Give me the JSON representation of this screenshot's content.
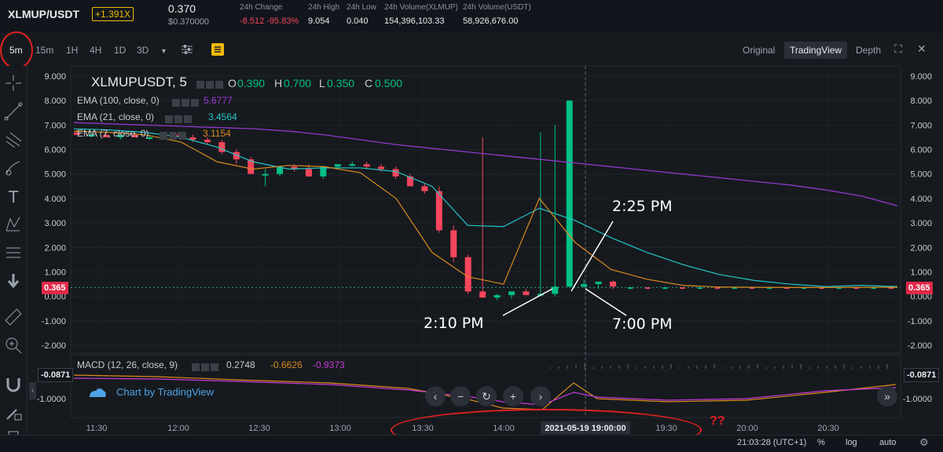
{
  "header": {
    "pair": "XLMUP/USDT",
    "leverage": "+1.391X",
    "price": "0.370",
    "price_sub": "$0.370000",
    "stats": [
      {
        "label": "24h Change",
        "value": "-8.512 -95.83%",
        "color": "#f6465d"
      },
      {
        "label": "24h High",
        "value": "9.054",
        "color": "#eaecef"
      },
      {
        "label": "24h Low",
        "value": "0.040",
        "color": "#eaecef"
      },
      {
        "label": "24h Volume(XLMUP)",
        "value": "154,396,103.33",
        "color": "#eaecef"
      },
      {
        "label": "24h Volume(USDT)",
        "value": "58,926,676.00",
        "color": "#eaecef"
      }
    ]
  },
  "toolbar": {
    "timeframes": [
      "5m",
      "15m",
      "1H",
      "4H",
      "1D",
      "3D"
    ],
    "active_timeframe": "5m",
    "views": [
      "Original",
      "TradingView",
      "Depth"
    ],
    "active_view": "TradingView"
  },
  "legend": {
    "symbol": "XLMUPUSDT, 5",
    "ohlc": {
      "o": "0.390",
      "h": "0.700",
      "l": "0.350",
      "c": "0.500"
    },
    "ema100": {
      "label": "EMA (100, close, 0)",
      "value": "5.6777",
      "color": "#9c3ad9"
    },
    "ema21": {
      "label": "EMA (21, close, 0)",
      "value": "3.4564",
      "color": "#24c6c8"
    },
    "ema7": {
      "label": "EMA (7, close, 0)",
      "value": "3.1154",
      "color": "#d98a1e"
    },
    "macd": {
      "label": "MACD (12, 26, close, 9)",
      "v1": "0.2748",
      "v2": "-0.6626",
      "v3": "-0.9373"
    }
  },
  "price_tag": "0.365",
  "macd_tag": "-0.0871",
  "branding": "Chart by TradingView",
  "annotations": {
    "a1": "2:25 PM",
    "a2": "2:10 PM",
    "a3": "7:00 PM",
    "question": "??"
  },
  "footer": {
    "time": "21:03:28 (UTC+1)",
    "percent": "%",
    "log": "log",
    "auto": "auto"
  },
  "chart_data": {
    "type": "candlestick",
    "x_ticks": [
      "11:30",
      "12:00",
      "12:30",
      "13:00",
      "13:30",
      "14:00",
      "2021-05-19 19:00:00",
      "19:30",
      "20:00",
      "20:30"
    ],
    "y_ticks": [
      "9.000",
      "8.000",
      "7.000",
      "6.000",
      "5.000",
      "4.000",
      "3.000",
      "2.000",
      "1.000",
      "0.000",
      "-1.000",
      "-2.000"
    ],
    "macd_y_ticks": [
      "-1.0000"
    ],
    "ylim": [
      -2,
      9
    ],
    "candles": [
      {
        "o": 6.7,
        "h": 6.8,
        "l": 6.6,
        "c": 6.6
      },
      {
        "o": 6.6,
        "h": 6.7,
        "l": 6.5,
        "c": 6.6
      },
      {
        "o": 6.6,
        "h": 6.7,
        "l": 6.5,
        "c": 6.5
      },
      {
        "o": 6.5,
        "h": 6.6,
        "l": 6.4,
        "c": 6.6
      },
      {
        "o": 6.6,
        "h": 6.7,
        "l": 6.5,
        "c": 6.5
      },
      {
        "o": 6.5,
        "h": 6.6,
        "l": 6.4,
        "c": 6.5
      },
      {
        "o": 6.5,
        "h": 6.6,
        "l": 6.4,
        "c": 6.6
      },
      {
        "o": 6.6,
        "h": 6.7,
        "l": 6.5,
        "c": 6.5
      },
      {
        "o": 6.5,
        "h": 6.6,
        "l": 6.3,
        "c": 6.4
      },
      {
        "o": 6.4,
        "h": 6.5,
        "l": 6.2,
        "c": 6.3
      },
      {
        "o": 6.3,
        "h": 6.4,
        "l": 5.8,
        "c": 5.9
      },
      {
        "o": 5.9,
        "h": 6.0,
        "l": 5.4,
        "c": 5.6
      },
      {
        "o": 5.6,
        "h": 5.7,
        "l": 5.0,
        "c": 5.0
      },
      {
        "o": 5.0,
        "h": 5.2,
        "l": 4.5,
        "c": 5.0
      },
      {
        "o": 5.0,
        "h": 5.3,
        "l": 4.9,
        "c": 5.3
      },
      {
        "o": 5.3,
        "h": 5.4,
        "l": 5.1,
        "c": 5.2
      },
      {
        "o": 5.2,
        "h": 5.4,
        "l": 5.0,
        "c": 4.9
      },
      {
        "o": 4.9,
        "h": 5.3,
        "l": 4.8,
        "c": 5.3
      },
      {
        "o": 5.3,
        "h": 5.4,
        "l": 5.2,
        "c": 5.4
      },
      {
        "o": 5.4,
        "h": 5.5,
        "l": 5.3,
        "c": 5.4
      },
      {
        "o": 5.4,
        "h": 5.5,
        "l": 5.2,
        "c": 5.3
      },
      {
        "o": 5.3,
        "h": 5.4,
        "l": 5.1,
        "c": 5.2
      },
      {
        "o": 5.2,
        "h": 5.3,
        "l": 4.8,
        "c": 4.9
      },
      {
        "o": 4.9,
        "h": 5.0,
        "l": 4.5,
        "c": 4.5
      },
      {
        "o": 4.5,
        "h": 4.6,
        "l": 4.2,
        "c": 4.3
      },
      {
        "o": 4.3,
        "h": 4.5,
        "l": 2.6,
        "c": 2.7
      },
      {
        "o": 2.7,
        "h": 2.9,
        "l": 1.4,
        "c": 1.6
      },
      {
        "o": 1.6,
        "h": 1.7,
        "l": 0.1,
        "c": 0.2
      },
      {
        "o": 0.2,
        "h": 6.5,
        "l": -0.05,
        "c": -0.05
      },
      {
        "o": -0.05,
        "h": 0.1,
        "l": -0.15,
        "c": 0.05
      },
      {
        "o": 0.05,
        "h": 0.15,
        "l": -0.1,
        "c": 0.2
      },
      {
        "o": 0.2,
        "h": 0.3,
        "l": 0.1,
        "c": 0.05
      },
      {
        "o": 0.05,
        "h": 6.7,
        "l": 0.0,
        "c": 0.1
      },
      {
        "o": 0.1,
        "h": 7.0,
        "l": 0.0,
        "c": 0.4
      },
      {
        "o": 0.4,
        "h": 8.0,
        "l": 0.35,
        "c": 8.0
      },
      {
        "o": 0.4,
        "h": 0.7,
        "l": 0.35,
        "c": 0.5
      },
      {
        "o": 0.5,
        "h": 0.6,
        "l": 0.3,
        "c": 0.6
      },
      {
        "o": 0.6,
        "h": 0.65,
        "l": 0.3,
        "c": 0.4
      }
    ],
    "ema100": [
      7.1,
      7.05,
      7.0,
      6.95,
      6.9,
      6.85,
      6.75,
      6.6,
      6.4,
      6.2,
      6.05,
      5.9,
      5.75,
      5.6,
      5.45,
      5.3,
      5.15,
      5.0,
      4.85,
      4.7,
      4.55,
      4.35,
      4.1,
      3.7
    ],
    "ema21": [
      6.85,
      6.8,
      6.7,
      6.5,
      6.1,
      5.5,
      5.2,
      5.25,
      5.25,
      5.1,
      4.5,
      2.9,
      2.85,
      3.6,
      3.1,
      2.4,
      1.8,
      1.3,
      0.9,
      0.65,
      0.5,
      0.4,
      0.45,
      0.4
    ],
    "ema7": [
      6.75,
      6.7,
      6.6,
      6.3,
      5.5,
      5.2,
      5.35,
      5.3,
      5.05,
      4.0,
      1.8,
      0.8,
      0.5,
      4.0,
      2.2,
      1.1,
      0.7,
      0.45,
      0.38,
      0.37,
      0.36,
      0.36,
      0.37,
      0.37
    ]
  }
}
